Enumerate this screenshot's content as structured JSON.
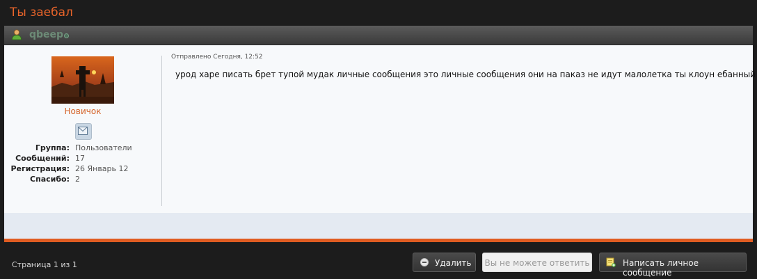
{
  "topic": {
    "title": "Ты заебал"
  },
  "author": {
    "name": "qbeep",
    "rank": "Новичок",
    "stats": [
      {
        "label": "Группа:",
        "value": "Пользователи"
      },
      {
        "label": "Сообщений:",
        "value": "17"
      },
      {
        "label": "Регистрация:",
        "value": "26 Январь 12"
      },
      {
        "label": "Спасибо:",
        "value": "2"
      }
    ]
  },
  "post": {
    "meta": "Отправлено Сегодня, 12:52",
    "body": "урод харе писать брет тупой мудак личные сообщения это личные сообщения они на паказ не идут малолетка ты клоун ебанный )_"
  },
  "pagination": {
    "text": "Страница 1 из 1"
  },
  "actions": {
    "delete_label": "Удалить",
    "no_reply_label": "Вы не можете ответить",
    "compose_label": "Написать личное сообщение"
  },
  "colors": {
    "accent": "#e05c22",
    "title": "#e8642a",
    "background": "#1c1c1c",
    "post_bg": "#f7f9fb"
  },
  "icons": {
    "user": "user-icon",
    "status": "online-status-icon",
    "pm": "envelope-icon",
    "delete": "minus-circle-icon",
    "compose": "note-add-icon"
  }
}
